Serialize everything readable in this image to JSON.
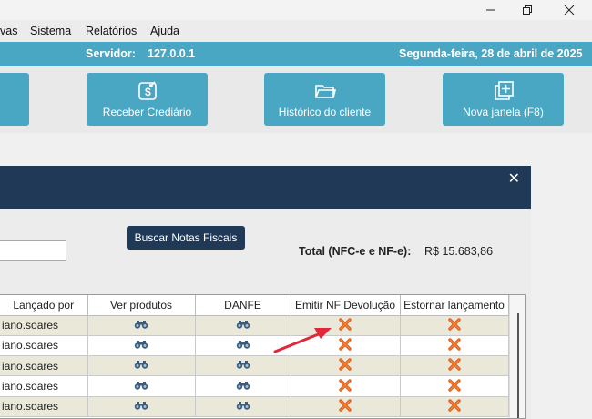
{
  "window": {
    "minimize": "—",
    "maximize": "▢",
    "close": "✕"
  },
  "menu": {
    "items": [
      "vas",
      "Sistema",
      "Relatórios",
      "Ajuda"
    ]
  },
  "status": {
    "server_label": "Servidor:",
    "server_value": "127.0.0.1",
    "date": "Segunda-feira, 28 de abril de 2025"
  },
  "toolbar": {
    "buttons": [
      {
        "label": "Receber Crediário",
        "icon": "money-receive-icon"
      },
      {
        "label": "Histórico do cliente",
        "icon": "folder-icon"
      },
      {
        "label": "Nova janela (F8)",
        "icon": "new-window-icon"
      }
    ]
  },
  "dialog": {
    "close": "✕",
    "search_button": "Buscar Notas Fiscais",
    "total_label": "Total (NFC-e e NF-e):",
    "total_value": "R$ 15.683,86"
  },
  "table": {
    "columns": [
      "Lançado por",
      "Ver produtos",
      "DANFE",
      "Emitir NF Devolução",
      "Estornar lançamento"
    ],
    "rows": [
      {
        "user": "iano.soares"
      },
      {
        "user": "iano.soares"
      },
      {
        "user": "iano.soares"
      },
      {
        "user": "iano.soares"
      },
      {
        "user": "iano.soares"
      }
    ],
    "view_icon": "binoculars-icon",
    "action_icon": "red-x-icon"
  },
  "colors": {
    "accent": "#4aa7c4",
    "dialog_header": "#1f3957",
    "row_alt": "#e9e8d9",
    "annotation": "#e0283a"
  }
}
